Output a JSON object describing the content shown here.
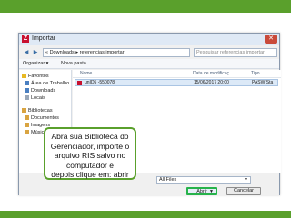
{
  "colors": {
    "accent_green": "#5aa02c",
    "highlight_green": "#27b34b",
    "selection": "#dce9f7"
  },
  "dialog": {
    "title": "Importar",
    "app_icon": "Z",
    "close_glyph": "✕",
    "address_path": "« Downloads ▸ referencias importar",
    "search_placeholder": "Pesquisar referencias importar",
    "toolbar": {
      "organize": "Organizar ▾",
      "new_folder": "Nova pasta"
    },
    "nav": [
      {
        "label": "Favoritos",
        "icon": "star-icon"
      },
      {
        "label": "Área de Trabalho",
        "icon": "desktop-icon"
      },
      {
        "label": "Downloads",
        "icon": "download-icon"
      },
      {
        "label": "Locais",
        "icon": "places-icon"
      },
      {
        "label": "Bibliotecas",
        "icon": "library-icon"
      },
      {
        "label": "Documentos",
        "icon": "document-icon"
      },
      {
        "label": "Imagens",
        "icon": "image-icon"
      },
      {
        "label": "Músicas",
        "icon": "music-icon"
      }
    ],
    "columns": {
      "name": "Nome",
      "date": "Data de modificaç...",
      "type": "Tipo"
    },
    "file": {
      "name": "unID5 -550078",
      "date": "15/06/2017 20:00",
      "type": "PASW Sta"
    },
    "filter": "All Files",
    "open_button": "Abrir",
    "cancel_button": "Cancelar"
  },
  "callout": {
    "line1": "Abra sua Biblioteca do",
    "line2": "Gerenciador, importe o",
    "line3": "arquivo RIS salvo no",
    "line4": "computador e",
    "line5": "depois clique em: abrir"
  }
}
